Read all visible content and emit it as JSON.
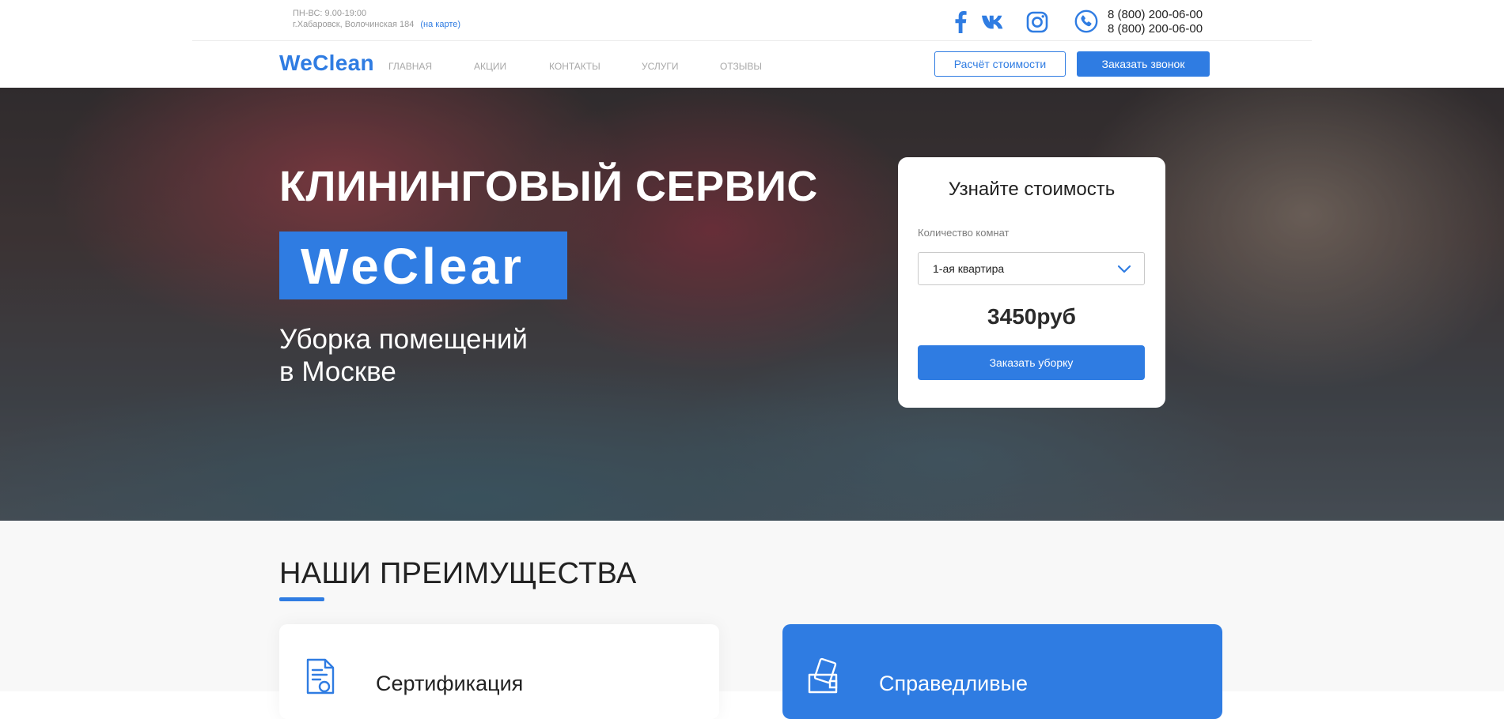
{
  "topbar": {
    "schedule": "ПН-ВС: 9.00-19:00",
    "address": "г.Хабаровск, Волочинская 184",
    "map_link": "(на карте)",
    "socials": [
      {
        "name": "facebook",
        "icon": "facebook-icon"
      },
      {
        "name": "vk",
        "icon": "vk-icon"
      },
      {
        "name": "instagram",
        "icon": "instagram-icon"
      }
    ],
    "phone_icon": "phone-icon",
    "phones": [
      "8 (800) 200-06-00",
      "8 (800) 200-06-00"
    ]
  },
  "nav": {
    "logo": "WeClean",
    "menu": [
      "ГЛАВНАЯ",
      "АКЦИИ",
      "КОНТАКТЫ",
      "УСЛУГИ",
      "ОТЗЫВЫ"
    ],
    "calc_button": "Расчёт стоимости",
    "callback_button": "Заказать звонок"
  },
  "hero": {
    "title": "КЛИНИНГОВЫЙ СЕРВИС",
    "brand": "WeClear",
    "subtitle_line1": "Уборка помещений",
    "subtitle_line2": "в Москве"
  },
  "calculator": {
    "title": "Узнайте стоимость",
    "rooms_label": "Количество комнат",
    "rooms_value": "1-ая квартира",
    "price": "3450руб",
    "order_button": "Заказать уборку"
  },
  "advantages": {
    "title": "НАШИ ПРЕИМУЩЕСТВА",
    "cards": [
      {
        "title": "Сертификация",
        "icon": "certificate-icon"
      },
      {
        "title": "Справедливые",
        "icon": "wallet-cards-icon"
      }
    ]
  },
  "colors": {
    "accent": "#2f7ce2",
    "muted_text": "#a8a8a8",
    "section_bg": "#f8f8f8"
  }
}
